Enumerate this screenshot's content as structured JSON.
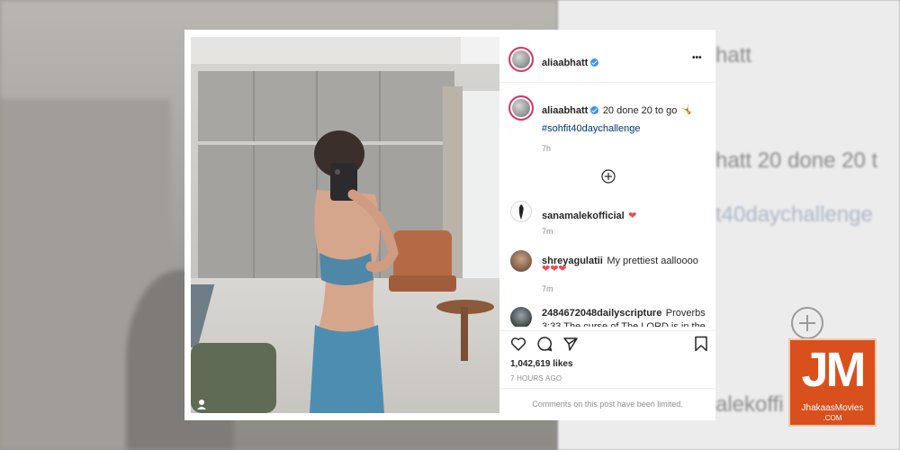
{
  "backdrop": {
    "username_fragment": "hatt",
    "caption_fragment": "hatt  20 done 20 t",
    "hashtag_fragment": "t40daychallenge",
    "commenter_fragment": "alekoffi"
  },
  "post": {
    "author": {
      "username": "aliaabhatt",
      "verified": true,
      "avatar_icon": "avatar-icon"
    },
    "more_options_label": "•••",
    "caption": {
      "username": "aliaabhatt",
      "text": "20 done 20 to go",
      "emoji": "🤸",
      "hashtag": "#sohfit40daychallenge",
      "time": "7h"
    },
    "load_more_icon": "plus-circle-icon",
    "comments": [
      {
        "username": "sanamalekofficial",
        "text": "",
        "hearts": "❤",
        "time": "7m"
      },
      {
        "username": "shreyagulatii",
        "text": "My prettiest aalloooo",
        "hearts": "❤❤❤",
        "time": "7m"
      },
      {
        "username": "2484672048dailyscripture",
        "text": "Proverbs 3:33 The curse of The LORD is in the",
        "hearts": "",
        "time": ""
      }
    ],
    "actions": {
      "like_icon": "heart-outline-icon",
      "comment_icon": "comment-icon",
      "share_icon": "send-icon",
      "save_icon": "bookmark-icon"
    },
    "likes": "1,042,619 likes",
    "posted_ago": "7 HOURS AGO",
    "comments_limited": "Comments on this post have been limited."
  },
  "watermark": {
    "logo": "JM",
    "site": "JhakaasMovies",
    "tld": ".COM"
  },
  "colors": {
    "verified": "#3897f0",
    "heart": "#ed4956",
    "hashtag": "#00376b",
    "watermark": "#d9501c"
  }
}
